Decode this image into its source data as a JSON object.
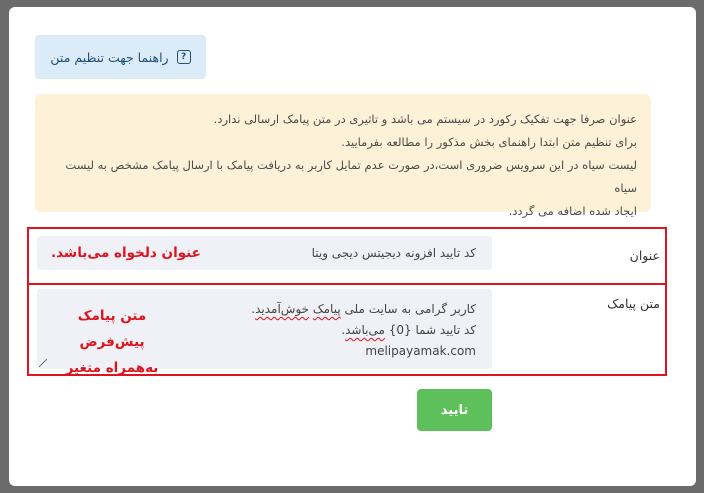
{
  "guide_button": {
    "label": "راهنما جهت تنظیم متن",
    "icon": "help-icon"
  },
  "notice": {
    "line1": "عنوان صرفا جهت تفکیک رکورد در سیستم می باشد و تاثیری در متن پیامک ارسالی ندارد.",
    "line2": "برای تنظیم متن ابتدا راهنمای بخش مذکور را مطالعه بفرمایید.",
    "line3": "لیست سیاه در این سرویس ضروری است،در صورت عدم تمایل کاربر به دریافت پیامک با ارسال پیامک مشخص به لیست سیاه",
    "line4": "ایجاد شده اضافه می گردد."
  },
  "title_field": {
    "label": "عنوان",
    "value": "کد تایید افزونه دیجیتس دیجی ویتا",
    "annotation": "عنوان دلخواه می‌باشد."
  },
  "body_field": {
    "label": "متن پیامک",
    "line1_part1": "کاربر گرامی به سایت ملی ",
    "line1_word1": "پیامک",
    "line1_space": " ",
    "line1_word2": "خوش‌آمدید",
    "line1_end": ".",
    "line2_part1": "کد تایید شما {0} ",
    "line2_word": "می‌باشد",
    "line2_end": ".",
    "line3": "melipayamak.com",
    "annotation_line1": "متن پیامک پیش‌فرض",
    "annotation_line2": "به‌همراه متغیر"
  },
  "submit_button": {
    "label": "تایید"
  },
  "colors": {
    "accent_red": "#e0141e",
    "submit_green": "#5ec05a",
    "notice_bg": "#fdf1d8",
    "guide_bg": "#dcebf8"
  }
}
